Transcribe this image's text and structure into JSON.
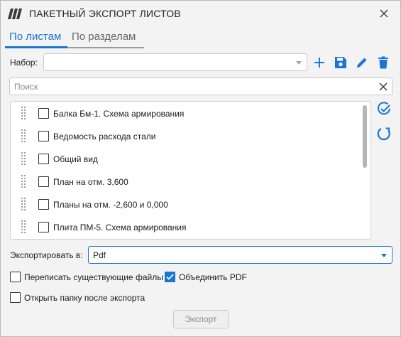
{
  "window": {
    "title": "ПАКЕТНЫЙ ЭКСПОРТ ЛИСТОВ"
  },
  "tabs": [
    {
      "label": "По листам",
      "active": true
    },
    {
      "label": "По разделам",
      "active": false
    }
  ],
  "set": {
    "label": "Набор:",
    "value": ""
  },
  "toolbar": {
    "add_icon": "plus-icon",
    "save_icon": "save-icon",
    "edit_icon": "pencil-icon",
    "delete_icon": "trash-icon"
  },
  "search": {
    "placeholder": "Поиск",
    "value": ""
  },
  "sheets": [
    {
      "name": "Балка Бм-1. Схема армирования",
      "checked": false
    },
    {
      "name": "Ведомость расхода стали",
      "checked": false
    },
    {
      "name": "Общий вид",
      "checked": false
    },
    {
      "name": "План на отм. 3,600",
      "checked": false
    },
    {
      "name": "Планы на отм. -2,600 и 0,000",
      "checked": false
    },
    {
      "name": "Плита ПМ-5. Схема армирования",
      "checked": false
    }
  ],
  "export": {
    "label": "Экспортировать в:",
    "format": "Pdf"
  },
  "options": {
    "overwrite": {
      "label": "Переписать существующие файлы",
      "checked": false
    },
    "merge_pdf": {
      "label": "Объединить PDF",
      "checked": true
    },
    "open_folder": {
      "label": "Открыть папку после экспорта",
      "checked": false
    }
  },
  "export_button": {
    "label": "Экспорт",
    "enabled": false
  },
  "colors": {
    "accent": "#1976d2",
    "icon_blue": "#1976d2",
    "disabled_text": "#8a8a8a"
  }
}
